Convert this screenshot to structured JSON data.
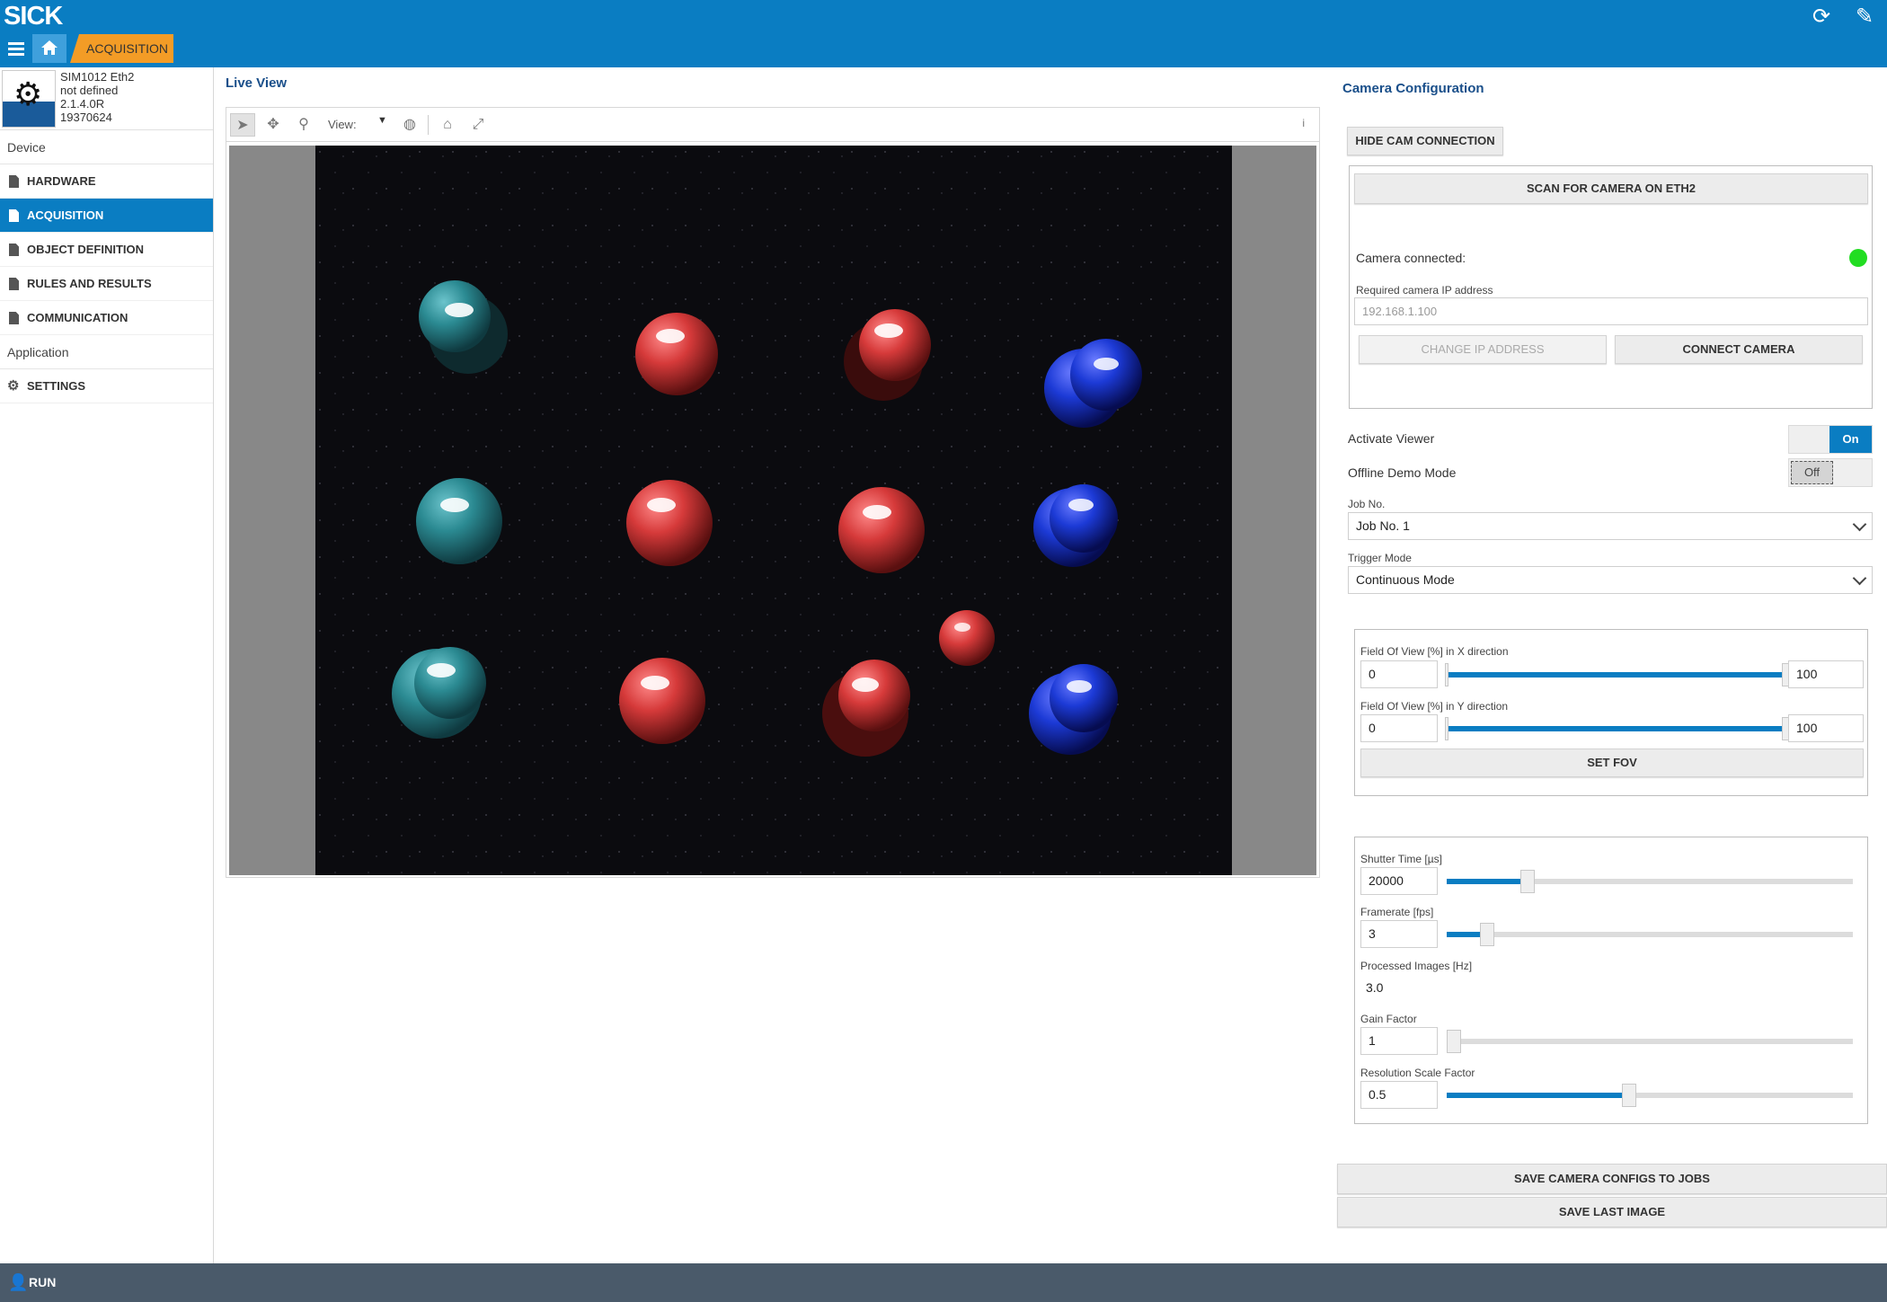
{
  "header": {
    "logo": "SICK",
    "breadcrumb": "ACQUISITION",
    "icons": [
      "refresh-icon",
      "edit-icon"
    ]
  },
  "device": {
    "name": "SIM1012 Eth2",
    "location": "not defined",
    "version": "2.1.4.0R",
    "serial": "19370624"
  },
  "sidebar": {
    "section_device": "Device",
    "section_application": "Application",
    "items": [
      {
        "label": "HARDWARE"
      },
      {
        "label": "ACQUISITION"
      },
      {
        "label": "OBJECT DEFINITION"
      },
      {
        "label": "RULES AND RESULTS"
      },
      {
        "label": "COMMUNICATION"
      }
    ],
    "settings": "SETTINGS"
  },
  "live_view": {
    "title": "Live View",
    "view_label": "View:",
    "info": "i"
  },
  "camera_config": {
    "title": "Camera Configuration",
    "hide_cam_connection": "HIDE CAM CONNECTION",
    "scan_button": "SCAN FOR CAMERA ON ETH2",
    "camera_connected_label": "Camera connected:",
    "status_color": "#22dd22",
    "ip_label": "Required camera IP address",
    "ip_placeholder": "192.168.1.100",
    "change_ip": "CHANGE IP ADDRESS",
    "connect_camera": "CONNECT CAMERA",
    "activate_viewer_label": "Activate Viewer",
    "activate_viewer_state": "On",
    "offline_demo_label": "Offline Demo Mode",
    "offline_demo_state": "Off",
    "job_label": "Job No.",
    "job_value": "Job No. 1",
    "trigger_label": "Trigger Mode",
    "trigger_value": "Continuous Mode",
    "fov_x_label": "Field Of View [%] in X direction",
    "fov_x_min": "0",
    "fov_x_max": "100",
    "fov_y_label": "Field Of View [%] in Y direction",
    "fov_y_min": "0",
    "fov_y_max": "100",
    "set_fov": "SET FOV",
    "shutter_label": "Shutter Time [µs]",
    "shutter_value": "20000",
    "shutter_level": 0.2,
    "framerate_label": "Framerate [fps]",
    "framerate_value": "3",
    "framerate_level": 0.1,
    "processed_label": "Processed Images [Hz]",
    "processed_value": "3.0",
    "gain_label": "Gain Factor",
    "gain_value": "1",
    "gain_level": 0.0,
    "resolution_label": "Resolution Scale Factor",
    "resolution_value": "0.5",
    "resolution_level": 0.45,
    "save_configs": "SAVE CAMERA CONFIGS TO JOBS",
    "save_image": "SAVE LAST IMAGE"
  },
  "footer": {
    "mode": "RUN"
  },
  "colors": {
    "brand_blue": "#0a7dc2",
    "accent_orange": "#f39c26",
    "footer": "#4a5a6a"
  }
}
